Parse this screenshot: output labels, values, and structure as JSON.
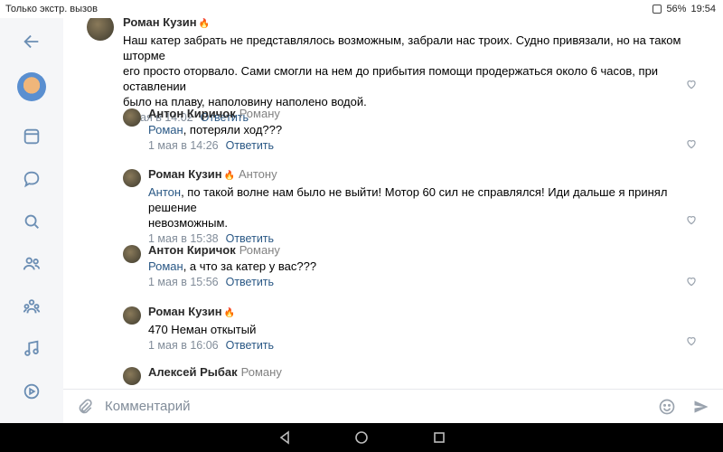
{
  "status_bar": {
    "left_text": "Только экстр. вызов",
    "battery": "56%",
    "time": "19:54"
  },
  "sidebar": {
    "items": [
      {
        "icon": "back-arrow-icon"
      },
      {
        "icon": "avatar"
      },
      {
        "icon": "news-icon"
      },
      {
        "icon": "messages-icon"
      },
      {
        "icon": "search-icon"
      },
      {
        "icon": "friends-icon"
      },
      {
        "icon": "communities-icon"
      },
      {
        "icon": "music-icon"
      },
      {
        "icon": "video-icon"
      }
    ]
  },
  "comments": [
    {
      "author": "Роман Кузин",
      "reply_to": "",
      "mention": "",
      "text_lines": [
        "Наш катер забрать не представлялось возможным, забрали нас троих. Судно привязали, но на таком шторме",
        "его просто оторвало. Сами смогли на нем до прибытия помощи продержаться около 6 часов, при оставлении",
        "было на плаву, наполовину наполено водой."
      ],
      "date": "1 мая в 14:02",
      "answer": "Ответить"
    },
    {
      "author": "Антон Киричок",
      "reply_to": "Роману",
      "mention": "Роман",
      "text_lines": [
        ", потеряли ход???"
      ],
      "date": "1 мая в 14:26",
      "answer": "Ответить"
    },
    {
      "author": "Роман Кузин",
      "reply_to": "Антону",
      "mention": "Антон",
      "text_lines": [
        ", по такой волне нам было не выйти! Мотор 60 сил не справлялся! Иди дальше я принял решение",
        "невозможным."
      ],
      "date": "1 мая в 15:38",
      "answer": "Ответить"
    },
    {
      "author": "Антон Киричок",
      "reply_to": "Роману",
      "mention": "Роман",
      "text_lines": [
        ", а что за катер у вас???"
      ],
      "date": "1 мая в 15:56",
      "answer": "Ответить"
    },
    {
      "author": "Роман Кузин",
      "reply_to": "",
      "mention": "",
      "text_lines": [
        "470  Неман откытый"
      ],
      "date": "1 мая в 16:06",
      "answer": "Ответить"
    },
    {
      "author": "Алексей Рыбак",
      "reply_to": "Роману",
      "mention": "",
      "text_lines": [
        "…"
      ],
      "date": "",
      "answer": ""
    }
  ],
  "input": {
    "placeholder": "Комментарий"
  },
  "colors": {
    "link": "#2a5885",
    "meta": "#818c99",
    "icon": "#6b8eb4"
  }
}
